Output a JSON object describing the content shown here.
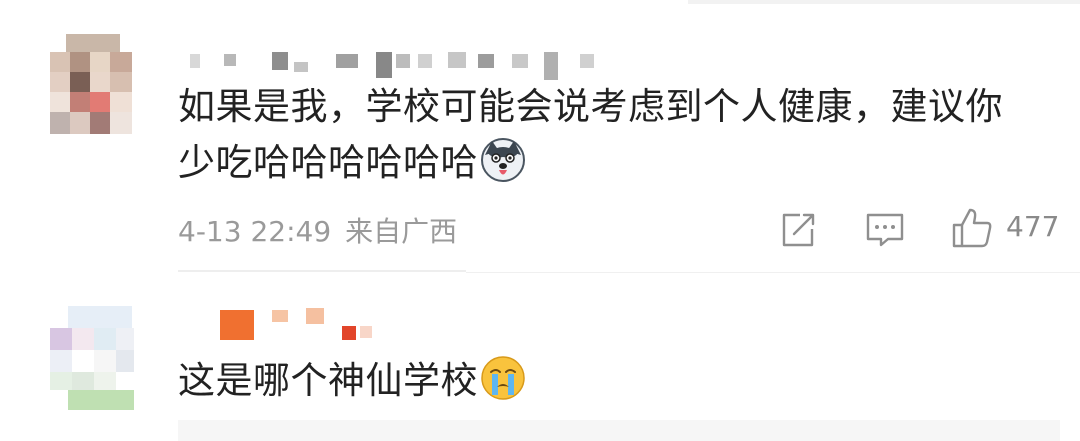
{
  "comments": [
    {
      "text_line1": "如果是我，学校可能会说考虑到个人健康，建议你",
      "text_line2": "少吃哈哈哈哈哈哈",
      "emoji": "husky-doge-emoji",
      "time": "4-13 22:49",
      "location": "来自广西",
      "likes": "477"
    },
    {
      "text_line1": "这是哪个神仙学校",
      "emoji": "crying-face-emoji"
    }
  ],
  "icons": [
    "share-icon",
    "comment-icon",
    "like-icon"
  ],
  "colors": {
    "text": "#222222",
    "meta": "#9a9a9a",
    "icon": "#9a9a9a",
    "accent_orange": "#f07030"
  }
}
